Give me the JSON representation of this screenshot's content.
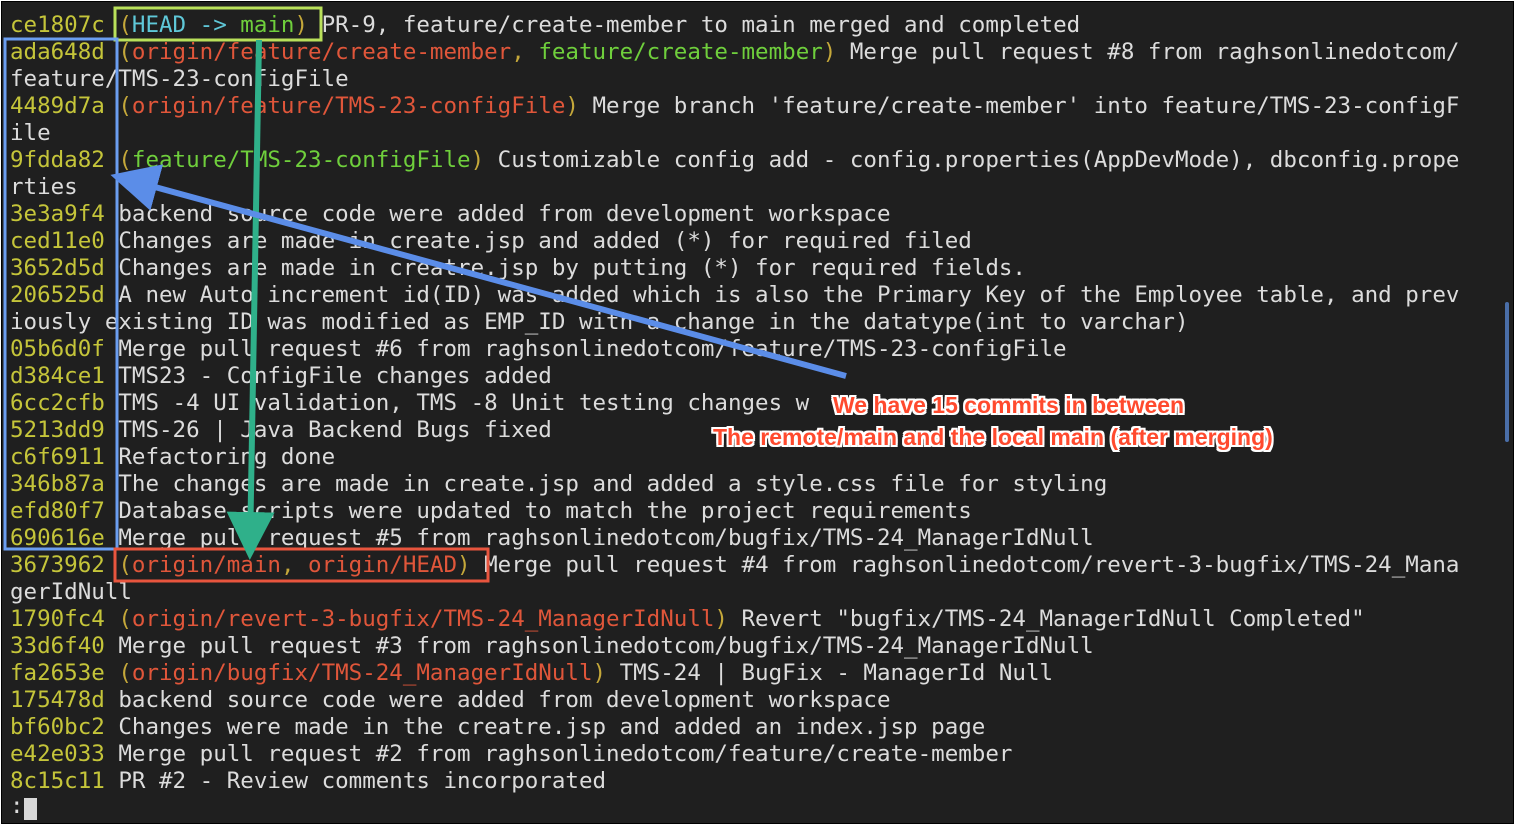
{
  "log": [
    {
      "hash": "ce1807c",
      "refs": [
        {
          "t": "head",
          "v": "HEAD"
        },
        {
          "t": "arrow",
          "v": " -> "
        },
        {
          "t": "lb",
          "v": "main"
        }
      ],
      "msg": "PR-9, feature/create-member to main merged and completed"
    },
    {
      "hash": "ada648d",
      "refs": [
        {
          "t": "rb",
          "v": "origin/feature/create-member"
        },
        {
          "t": "pn",
          "v": ", "
        },
        {
          "t": "lb",
          "v": "feature/create-member"
        }
      ],
      "msg": "Merge pull request #8 from raghsonlinedotcom/",
      "cont": "feature/TMS-23-configFile"
    },
    {
      "hash": "4489d7a",
      "refs": [
        {
          "t": "rb",
          "v": "origin/feature/TMS-23-configFile"
        }
      ],
      "msg": "Merge branch 'feature/create-member' into feature/TMS-23-configF",
      "cont": "ile"
    },
    {
      "hash": "9fdda82",
      "refs": [
        {
          "t": "lb",
          "v": "feature/TMS-23-configFile"
        }
      ],
      "msg": "Customizable config add - config.properties(AppDevMode), dbconfig.prope",
      "cont": "rties"
    },
    {
      "hash": "3e3a9f4",
      "msg": "backend source code were added from development workspace"
    },
    {
      "hash": "ced11e0",
      "msg": "Changes are made in create.jsp and added (*) for required filed"
    },
    {
      "hash": "3652d5d",
      "msg": "Changes are made in creatre.jsp by putting (*) for required fields."
    },
    {
      "hash": "206525d",
      "msg": "A new Auto increment id(ID) was added which is also the Primary Key of the Employee table, and prev",
      "cont": "iously existing ID was modified as EMP_ID with a change in the datatype(int to varchar)"
    },
    {
      "hash": "05b6d0f",
      "msg": "Merge pull request #6 from raghsonlinedotcom/feature/TMS-23-configFile"
    },
    {
      "hash": "d384ce1",
      "msg": "TMS23 - ConfigFile changes added"
    },
    {
      "hash": "6cc2cfb",
      "msg": "TMS -4 UI validation, TMS -8 Unit testing changes w"
    },
    {
      "hash": "5213dd9",
      "msg": "TMS-26 | Java Backend Bugs fixed"
    },
    {
      "hash": "c6f6911",
      "msg": "Refactoring done"
    },
    {
      "hash": "346b87a",
      "msg": "The changes are made in create.jsp and added a style.css file for styling"
    },
    {
      "hash": "efd80f7",
      "msg": "Database scripts were updated to match the project requirements"
    },
    {
      "hash": "690616e",
      "msg": "Merge pull request #5 from raghsonlinedotcom/bugfix/TMS-24_ManagerIdNull"
    },
    {
      "hash": "3673962",
      "refs": [
        {
          "t": "rb",
          "v": "origin/main"
        },
        {
          "t": "pn",
          "v": ", "
        },
        {
          "t": "rb",
          "v": "origin/HEAD"
        }
      ],
      "msg": "Merge pull request #4 from raghsonlinedotcom/revert-3-bugfix/TMS-24_Mana",
      "cont": "gerIdNull"
    },
    {
      "hash": "1790fc4",
      "refs": [
        {
          "t": "rb",
          "v": "origin/revert-3-bugfix/TMS-24_ManagerIdNull"
        }
      ],
      "msg": "Revert \"bugfix/TMS-24_ManagerIdNull Completed\""
    },
    {
      "hash": "33d6f40",
      "msg": "Merge pull request #3 from raghsonlinedotcom/bugfix/TMS-24_ManagerIdNull"
    },
    {
      "hash": "fa2653e",
      "refs": [
        {
          "t": "rb",
          "v": "origin/bugfix/TMS-24_ManagerIdNull"
        }
      ],
      "msg": "TMS-24 | BugFix - ManagerId Null"
    },
    {
      "hash": "175478d",
      "msg": "backend source code were added from development workspace"
    },
    {
      "hash": "bf60bc2",
      "msg": "Changes were made in the creatre.jsp and added an index.jsp page"
    },
    {
      "hash": "e42e033",
      "msg": "Merge pull request #2 from raghsonlinedotcom/feature/create-member"
    },
    {
      "hash": "8c15c11",
      "msg": "PR #2 - Review comments incorporated"
    }
  ],
  "prompt": ":",
  "annotation": {
    "line1": "We have 15 commits in between",
    "line2": "The remote/main and the local main (after merging)"
  },
  "colors": {
    "background": "#1f1f1f",
    "hash": "#c5c53a",
    "local_branch": "#6fcf3c",
    "remote_branch": "#e0563a",
    "head": "#5fc8d8",
    "box_green": "#b9e05a",
    "box_blue": "#6b9ef0",
    "box_red": "#e8553e",
    "arrow_blue": "#5b8de8",
    "arrow_teal": "#2fb08a",
    "annotation_text": "#ff4a2e"
  }
}
